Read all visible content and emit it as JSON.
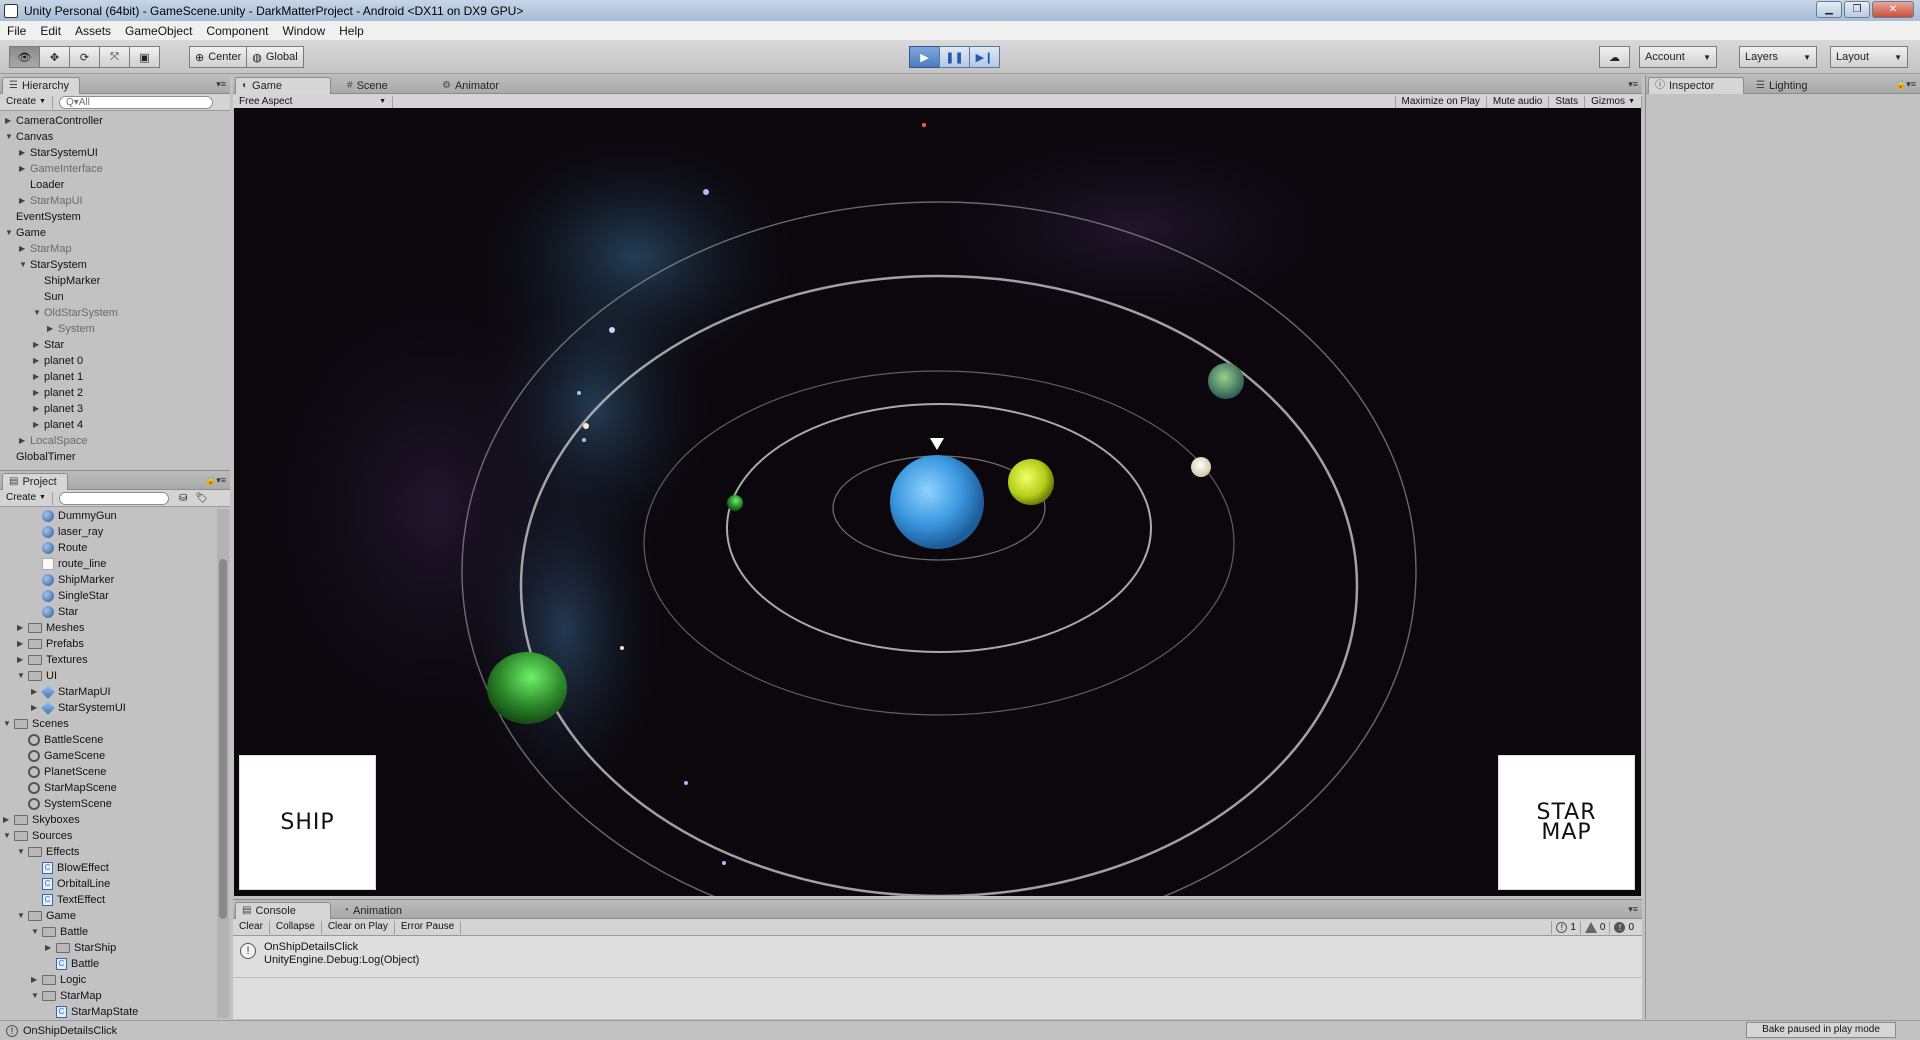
{
  "window": {
    "title": "Unity Personal (64bit) - GameScene.unity - DarkMatterProject - Android <DX11 on DX9 GPU>",
    "minimize": "▁",
    "maximize": "❐",
    "close": "✕"
  },
  "menu": [
    "File",
    "Edit",
    "Assets",
    "GameObject",
    "Component",
    "Window",
    "Help"
  ],
  "toolbar": {
    "pivot_label": "Center",
    "space_label": "Global",
    "account_label": "Account",
    "layers_label": "Layers",
    "layout_label": "Layout"
  },
  "hierarchy": {
    "tab": "Hierarchy",
    "create": "Create",
    "search_placeholder": "Q▾All",
    "items": [
      {
        "label": "CameraController",
        "depth": 0,
        "arrow": "▶",
        "dim": false
      },
      {
        "label": "Canvas",
        "depth": 0,
        "arrow": "▼",
        "dim": false
      },
      {
        "label": "StarSystemUI",
        "depth": 1,
        "arrow": "▶",
        "dim": false
      },
      {
        "label": "GameInterface",
        "depth": 1,
        "arrow": "▶",
        "dim": true
      },
      {
        "label": "Loader",
        "depth": 1,
        "arrow": "",
        "dim": false
      },
      {
        "label": "StarMapUI",
        "depth": 1,
        "arrow": "▶",
        "dim": true
      },
      {
        "label": "EventSystem",
        "depth": 0,
        "arrow": "",
        "dim": false
      },
      {
        "label": "Game",
        "depth": 0,
        "arrow": "▼",
        "dim": false
      },
      {
        "label": "StarMap",
        "depth": 1,
        "arrow": "▶",
        "dim": true
      },
      {
        "label": "StarSystem",
        "depth": 1,
        "arrow": "▼",
        "dim": false
      },
      {
        "label": "ShipMarker",
        "depth": 2,
        "arrow": "",
        "dim": false
      },
      {
        "label": "Sun",
        "depth": 2,
        "arrow": "",
        "dim": false
      },
      {
        "label": "OldStarSystem",
        "depth": 2,
        "arrow": "▼",
        "dim": true
      },
      {
        "label": "System",
        "depth": 3,
        "arrow": "▶",
        "dim": true
      },
      {
        "label": "Star",
        "depth": 2,
        "arrow": "▶",
        "dim": false
      },
      {
        "label": "planet 0",
        "depth": 2,
        "arrow": "▶",
        "dim": false
      },
      {
        "label": "planet 1",
        "depth": 2,
        "arrow": "▶",
        "dim": false
      },
      {
        "label": "planet 2",
        "depth": 2,
        "arrow": "▶",
        "dim": false
      },
      {
        "label": "planet 3",
        "depth": 2,
        "arrow": "▶",
        "dim": false
      },
      {
        "label": "planet 4",
        "depth": 2,
        "arrow": "▶",
        "dim": false
      },
      {
        "label": "LocalSpace",
        "depth": 1,
        "arrow": "▶",
        "dim": true
      },
      {
        "label": "GlobalTimer",
        "depth": 0,
        "arrow": "",
        "dim": false
      }
    ]
  },
  "project": {
    "tab": "Project",
    "create": "Create",
    "items": [
      {
        "label": "DummyGun",
        "depth": 2,
        "arrow": "",
        "icon": "sphere"
      },
      {
        "label": "laser_ray",
        "depth": 2,
        "arrow": "",
        "icon": "sphere"
      },
      {
        "label": "Route",
        "depth": 2,
        "arrow": "",
        "icon": "sphere"
      },
      {
        "label": "route_line",
        "depth": 2,
        "arrow": "",
        "icon": "white"
      },
      {
        "label": "ShipMarker",
        "depth": 2,
        "arrow": "",
        "icon": "sphere"
      },
      {
        "label": "SingleStar",
        "depth": 2,
        "arrow": "",
        "icon": "sphere"
      },
      {
        "label": "Star",
        "depth": 2,
        "arrow": "",
        "icon": "sphere"
      },
      {
        "label": "Meshes",
        "depth": 1,
        "arrow": "▶",
        "icon": "folder"
      },
      {
        "label": "Prefabs",
        "depth": 1,
        "arrow": "▶",
        "icon": "folder"
      },
      {
        "label": "Textures",
        "depth": 1,
        "arrow": "▶",
        "icon": "folder"
      },
      {
        "label": "UI",
        "depth": 1,
        "arrow": "▼",
        "icon": "folder"
      },
      {
        "label": "StarMapUI",
        "depth": 2,
        "arrow": "▶",
        "icon": "prefab"
      },
      {
        "label": "StarSystemUI",
        "depth": 2,
        "arrow": "▶",
        "icon": "prefab"
      },
      {
        "label": "Scenes",
        "depth": 0,
        "arrow": "▼",
        "icon": "folder"
      },
      {
        "label": "BattleScene",
        "depth": 1,
        "arrow": "",
        "icon": "scene"
      },
      {
        "label": "GameScene",
        "depth": 1,
        "arrow": "",
        "icon": "scene"
      },
      {
        "label": "PlanetScene",
        "depth": 1,
        "arrow": "",
        "icon": "scene"
      },
      {
        "label": "StarMapScene",
        "depth": 1,
        "arrow": "",
        "icon": "scene"
      },
      {
        "label": "SystemScene",
        "depth": 1,
        "arrow": "",
        "icon": "scene"
      },
      {
        "label": "Skyboxes",
        "depth": 0,
        "arrow": "▶",
        "icon": "folder"
      },
      {
        "label": "Sources",
        "depth": 0,
        "arrow": "▼",
        "icon": "folder"
      },
      {
        "label": "Effects",
        "depth": 1,
        "arrow": "▼",
        "icon": "folder"
      },
      {
        "label": "BlowEffect",
        "depth": 2,
        "arrow": "",
        "icon": "script"
      },
      {
        "label": "OrbitalLine",
        "depth": 2,
        "arrow": "",
        "icon": "script"
      },
      {
        "label": "TextEffect",
        "depth": 2,
        "arrow": "",
        "icon": "script"
      },
      {
        "label": "Game",
        "depth": 1,
        "arrow": "▼",
        "icon": "folder"
      },
      {
        "label": "Battle",
        "depth": 2,
        "arrow": "▼",
        "icon": "folder"
      },
      {
        "label": "StarShip",
        "depth": 3,
        "arrow": "▶",
        "icon": "folder"
      },
      {
        "label": "Battle",
        "depth": 3,
        "arrow": "",
        "icon": "script"
      },
      {
        "label": "Logic",
        "depth": 2,
        "arrow": "▶",
        "icon": "folder"
      },
      {
        "label": "StarMap",
        "depth": 2,
        "arrow": "▼",
        "icon": "folder"
      },
      {
        "label": "StarMapState",
        "depth": 3,
        "arrow": "",
        "icon": "script"
      }
    ]
  },
  "center_tabs": {
    "game": "Game",
    "scene": "Scene",
    "animator": "Animator",
    "aspect": "Free Aspect",
    "options": [
      "Maximize on Play",
      "Mute audio",
      "Stats",
      "Gizmos"
    ]
  },
  "game_ui": {
    "ship_button": "SHIP",
    "starmap_line1": "STAR",
    "starmap_line2": "MAP"
  },
  "right_tabs": {
    "inspector": "Inspector",
    "lighting": "Lighting"
  },
  "console": {
    "tab": "Console",
    "animation_tab": "Animation",
    "buttons": [
      "Clear",
      "Collapse",
      "Clear on Play",
      "Error Pause"
    ],
    "info_count": "1",
    "warning_count": "0",
    "error_count": "0",
    "log_line1": "OnShipDetailsClick",
    "log_line2": "UnityEngine.Debug:Log(Object)"
  },
  "statusbar": {
    "message": "OnShipDetailsClick",
    "bake": "Bake paused in play mode"
  },
  "colors": {
    "planet_blue": "#4aa7e6",
    "planet_yellow": "#c9de2a",
    "planet_green": "#2e8c2e",
    "orbit": "#c8c8c8",
    "play_blue": "#4d7cc0"
  }
}
